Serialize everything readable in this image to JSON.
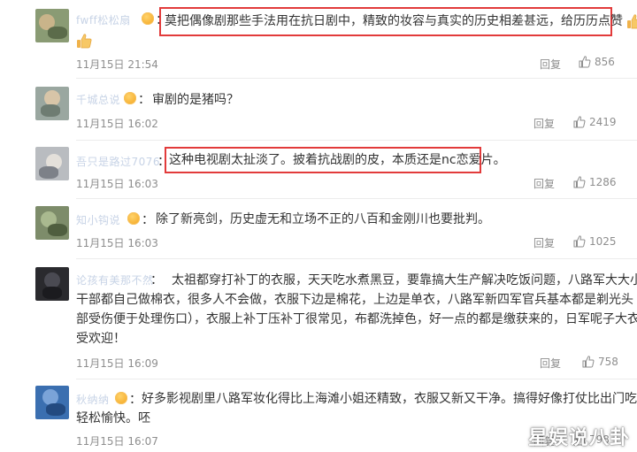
{
  "comments": [
    {
      "username": "fwff松松扇",
      "text_line1": "莫把偶像剧那些手法用在抗日剧中，精致的妆容与真实的历史相差甚远，给历历点赞",
      "text_line2": "",
      "time": "11月15日 21:54",
      "reply": "回复",
      "likes": "856"
    },
    {
      "username": "千城总说",
      "text_line1": "审剧的是猪吗？",
      "time": "11月15日 16:02",
      "reply": "回复",
      "likes": "2419"
    },
    {
      "username": "吾只是路过7076",
      "text_line1": "这种电视剧太扯淡了。披着抗战剧的皮，本质还是nc恋爱片。",
      "time": "11月15日 16:03",
      "reply": "回复",
      "likes": "1286"
    },
    {
      "username": "知小钩说",
      "text_line1": "除了新亮剑，历史虚无和立场不正的八百和金刚川也要批判。",
      "time": "11月15日 16:03",
      "reply": "回复",
      "likes": "1025"
    },
    {
      "username": "论孩有美那不然",
      "text_line1": "太祖都穿打补丁的衣服，天天吃水煮黑豆，要靠搞大生产解决吃饭问题，八路军大大小小",
      "text_line2": "干部都自己做棉衣，很多人不会做，衣服下边是棉花，上边是单衣，八路军新四军官兵基本都是剃光头（头",
      "text_line3": "部受伤便于处理伤口），衣服上补丁压补丁很常见，布都洗掉色，好一点的都是缴获来的，日军呢子大衣很",
      "text_line4": "受欢迎！",
      "time": "11月15日 16:09",
      "reply": "回复",
      "likes": "758"
    },
    {
      "username": "秋纳纳",
      "text_line1": "好多影视剧里八路军妆化得比上海滩小姐还精致，衣服又新又干净。搞得好像打仗比出门吃饭还",
      "text_line2": "轻松愉快。呸",
      "time": "11月15日 16:07",
      "reply": "回复",
      "likes": "798"
    }
  ],
  "watermark": "星娱说八卦",
  "colors": {
    "highlight": "#e23b3b",
    "meta_text": "#8e8e8e",
    "username_blur": "#c7d3e6"
  },
  "icons": {
    "like": "thumbs-up-icon",
    "emoji": "thumbs-up-emoji",
    "vip": "vip-badge-icon"
  }
}
